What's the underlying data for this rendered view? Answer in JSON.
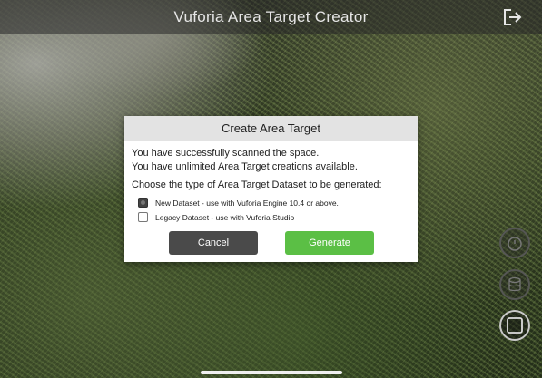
{
  "app": {
    "title": "Vuforia Area Target Creator",
    "exit_icon": "exit-icon"
  },
  "dialog": {
    "title": "Create Area Target",
    "message_line1": "You have successfully scanned the space.",
    "message_line2": "You have unlimited Area Target creations available.",
    "prompt": "Choose the type of Area Target Dataset to be generated:",
    "options": [
      {
        "label": "New Dataset - use with Vuforia Engine 10.4 or above.",
        "checked": true
      },
      {
        "label": "Legacy Dataset - use with Vuforia Studio",
        "checked": false
      }
    ],
    "cancel_label": "Cancel",
    "generate_label": "Generate"
  },
  "side_controls": {
    "icons": [
      "timer-icon",
      "database-icon",
      "stop-icon"
    ]
  },
  "colors": {
    "generate": "#5bbf45",
    "cancel": "#4a4a4a",
    "header": "#e3e3e3"
  }
}
